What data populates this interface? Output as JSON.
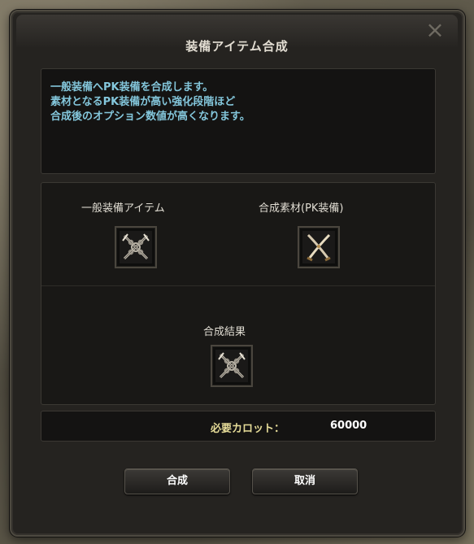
{
  "window": {
    "title": "装備アイテム合成",
    "close_icon": "close-icon"
  },
  "info": {
    "lines": [
      "一般装備へPK装備を合成します。",
      "素材となるPK装備が高い強化段階ほど",
      "合成後のオプション数値が高くなります。"
    ]
  },
  "slots": {
    "base": {
      "label": "一般装備アイテム",
      "icon": "crossed-swords-chained-icon"
    },
    "material": {
      "label": "合成素材(PK装備)",
      "icon": "crossed-blades-icon"
    },
    "result": {
      "label": "合成結果",
      "icon": "crossed-swords-chained-icon"
    }
  },
  "cost": {
    "label": "必要カロット：",
    "value": "60000"
  },
  "buttons": {
    "synthesize": "合成",
    "cancel": "取消"
  },
  "colors": {
    "info_text": "#84c7dc",
    "cost_label": "#e6dc98",
    "panel_bg": "#141312"
  }
}
